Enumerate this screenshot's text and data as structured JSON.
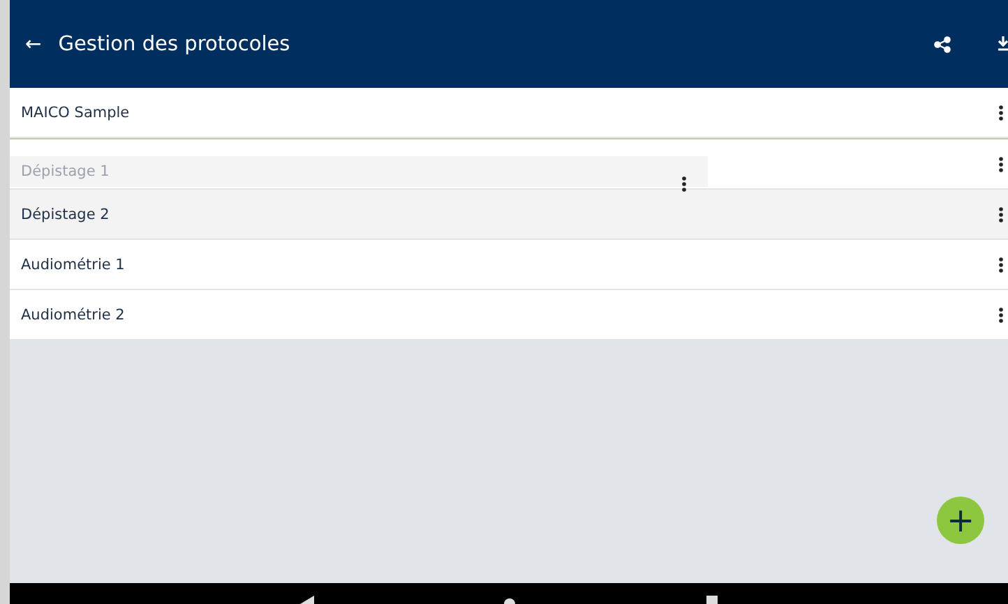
{
  "app_bar": {
    "title": "Gestion des protocoles",
    "back_icon": "←"
  },
  "protocols": [
    {
      "name": "MAICO Sample",
      "dragging": false,
      "highlighted": false
    },
    {
      "name": "Dépistage 1",
      "dragging": true,
      "highlighted": false
    },
    {
      "name": "Dépistage 2",
      "dragging": false,
      "highlighted": true
    },
    {
      "name": "Audiométrie 1",
      "dragging": false,
      "highlighted": false
    },
    {
      "name": "Audiométrie 2",
      "dragging": false,
      "highlighted": false
    }
  ],
  "fab": {
    "label": "+"
  }
}
